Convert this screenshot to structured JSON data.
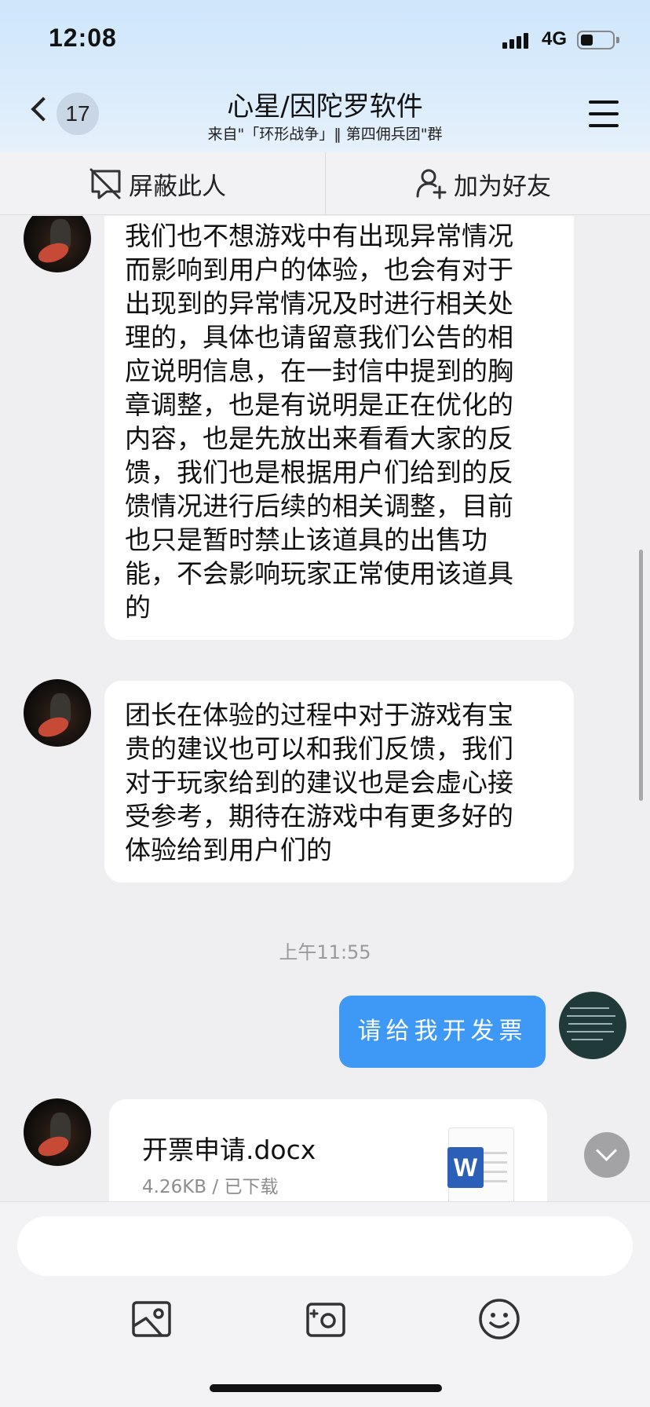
{
  "status_bar": {
    "time": "12:08",
    "network": "4G"
  },
  "header": {
    "unread_count": "17",
    "title": "心星/因陀罗软件",
    "subtitle": "来自\"「环形战争」‖ 第四佣兵团\"群"
  },
  "actions": {
    "block_label": "屏蔽此人",
    "add_friend_label": "加为好友"
  },
  "messages": {
    "msg1_lines": [
      "我们也不想游戏中有出现异常情况",
      "而影响到用户的体验，也会有对于",
      "出现到的异常情况及时进行相关处",
      "理的，具体也请留意我们公告的相",
      "应说明信息，在一封信中提到的胸",
      "章调整，也是有说明是正在优化的",
      "内容，也是先放出来看看大家的反",
      "馈，我们也是根据用户们给到的反",
      "馈情况进行后续的相关调整，目前",
      "也只是暂时禁止该道具的出售功",
      "能，不会影响玩家正常使用该道具",
      "的"
    ],
    "msg2_lines": [
      "团长在体验的过程中对于游戏有宝",
      "贵的建议也可以和我们反馈，我们",
      "对于玩家给到的建议也是会虚心接",
      "受参考，期待在游戏中有更多好的",
      "体验给到用户们的"
    ],
    "timestamp": "上午11:55",
    "outgoing_text": "请给我开发票",
    "file": {
      "name": "开票申请.docx",
      "meta": "4.26KB / 已下载",
      "icon_letter": "W"
    }
  },
  "input": {
    "placeholder": ""
  },
  "colors": {
    "accent_blue": "#3d98f6",
    "word_blue": "#2b5fb8"
  }
}
